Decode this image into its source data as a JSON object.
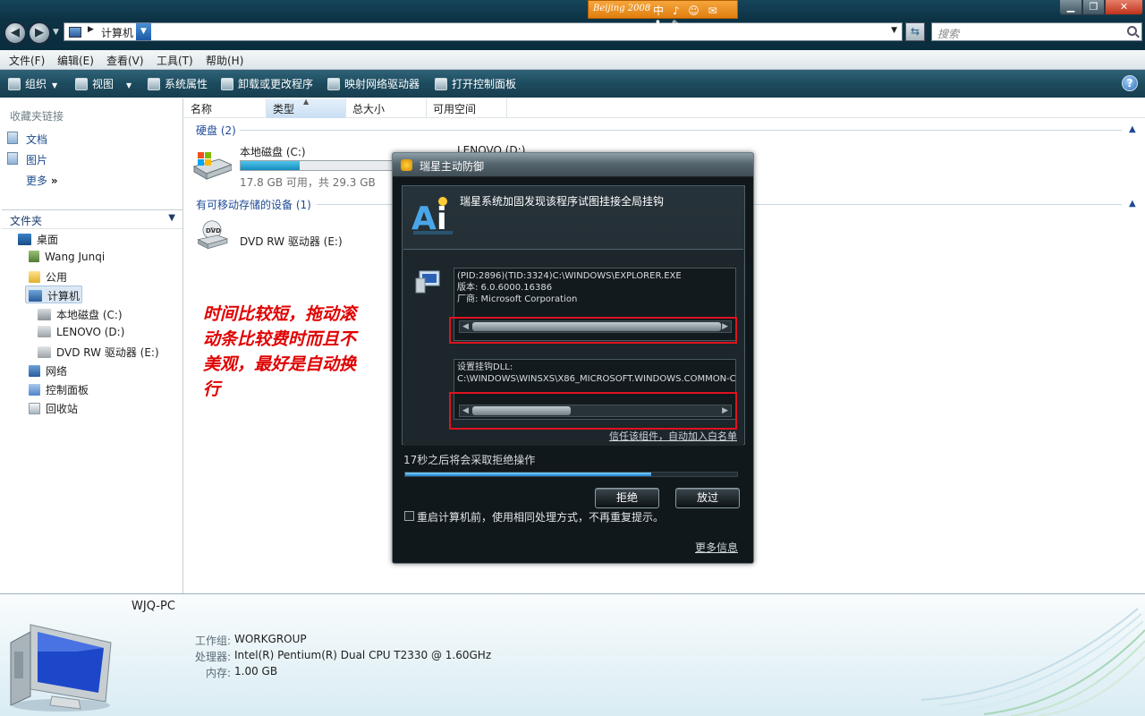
{
  "window": {
    "address_path": "计算机",
    "search_placeholder": "搜索",
    "olympic_bar_text": "Beijing 2008",
    "olympic_icons": "中 ♪ ☺ ✉ ♣ ✎"
  },
  "menu": [
    "文件(F)",
    "编辑(E)",
    "查看(V)",
    "工具(T)",
    "帮助(H)"
  ],
  "toolbar": {
    "organize": "组织",
    "views": "视图",
    "system_properties": "系统属性",
    "uninstall": "卸载或更改程序",
    "map_drive": "映射网络驱动器",
    "control_panel": "打开控制面板"
  },
  "sidebar": {
    "favorites_header": "收藏夹链接",
    "favorites": [
      "文档",
      "图片"
    ],
    "more": "更多",
    "folders_header": "文件夹",
    "tree": [
      "桌面",
      "Wang Junqi",
      "公用",
      "计算机",
      "本地磁盘 (C:)",
      "LENOVO (D:)",
      "DVD RW 驱动器 (E:)",
      "网络",
      "控制面板",
      "回收站"
    ]
  },
  "columns": [
    "名称",
    "类型",
    "总大小",
    "可用空间"
  ],
  "groups": {
    "hard_disks": "硬盘 (2)",
    "removable": "有可移动存储的设备 (1)"
  },
  "drives": {
    "c_name": "本地磁盘 (C:)",
    "c_used_fraction": 0.39,
    "c_size": "17.8 GB 可用，共 29.3 GB",
    "d_name": "LENOVO (D:)",
    "e_name": "DVD RW 驱动器 (E:)"
  },
  "annotation": "时间比较短，拖动滚动条比较费时而且不美观，最好是自动换行",
  "details": {
    "pc_name": "WJQ-PC",
    "workgroup_label": "工作组:",
    "workgroup": "WORKGROUP",
    "processor_label": "处理器:",
    "processor": "Intel(R) Pentium(R) Dual  CPU  T2330  @ 1.60GHz",
    "memory_label": "内存:",
    "memory": "1.00 GB"
  },
  "dialog": {
    "title": "瑞星主动防御",
    "headline": "瑞星系统加固发现该程序试图挂接全局挂钩",
    "process_line": "(PID:2896)(TID:3324)C:\\WINDOWS\\EXPLORER.EXE",
    "version_line": "版本: 6.0.6000.16386",
    "vendor_line": "厂商: Microsoft Corporation",
    "dll_label": "设置挂钩DLL:",
    "dll_path": "C:\\WINDOWS\\WINSXS\\X86_MICROSOFT.WINDOWS.COMMON-C",
    "trust_link": "信任该组件，自动加入白名单",
    "countdown": "17秒之后将会采取拒绝操作",
    "progress_fraction": 0.74,
    "reject": "拒绝",
    "allow": "放过",
    "remember": "重启计算机前，使用相同处理方式，不再重复提示。",
    "more_info": "更多信息"
  }
}
